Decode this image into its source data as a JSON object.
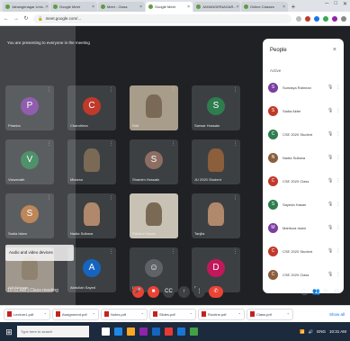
{
  "browser": {
    "tabs": [
      {
        "label": "Jahangirnagar Univ..."
      },
      {
        "label": "Google Meet"
      },
      {
        "label": "Meet - Class"
      },
      {
        "label": "Google Meet",
        "active": true
      },
      {
        "label": "JAHANGIRNAGAR..."
      },
      {
        "label": "Online Classes"
      }
    ],
    "url": "meet.google.com/..."
  },
  "meeting": {
    "banner": "You are presenting to everyone in the meeting",
    "tooltip": "Audio and video devices",
    "meeting_code": "10:31 AM  |  Class meeting",
    "tiles": [
      {
        "name": "Prianka",
        "initial": "P",
        "color": "#7b3fa0",
        "kind": "avatar"
      },
      {
        "name": "Chandrima",
        "initial": "C",
        "color": "#c0392b",
        "kind": "avatar"
      },
      {
        "name": "Rafi",
        "kind": "photo"
      },
      {
        "name": "Sarwar Hossain",
        "initial": "S",
        "color": "#2e7d4f",
        "kind": "avatar"
      },
      {
        "name": "Viswanath",
        "initial": "V",
        "color": "#2e7d4f",
        "kind": "avatar"
      },
      {
        "name": "Mizanur",
        "kind": "cam"
      },
      {
        "name": "Shamim Hossain",
        "initial": "S",
        "color": "#8d6e63",
        "kind": "avatar"
      },
      {
        "name": "JU 2020 Student",
        "kind": "cam2"
      },
      {
        "name": "Sadia Islam",
        "initial": "S",
        "color": "#b0703a",
        "kind": "avatar"
      },
      {
        "name": "Nadia Sultana",
        "kind": "cam3"
      },
      {
        "name": "Rakibul Hasan",
        "kind": "photo2"
      },
      {
        "name": "Tanjila",
        "kind": "cam3"
      },
      {
        "name": "Arif Rahman",
        "kind": "photo3"
      },
      {
        "name": "Abdullah Sayed",
        "initial": "A",
        "color": "#1565c0",
        "kind": "avatar"
      },
      {
        "name": "Dipti",
        "kind": "emoji"
      },
      {
        "name": "Dana",
        "initial": "D",
        "color": "#c2185b",
        "kind": "avatar"
      }
    ],
    "people_panel": {
      "title": "People",
      "section": "Active",
      "rows": [
        {
          "name": "Sumaiya Rahman",
          "color": "#7b3fa0",
          "initial": "S"
        },
        {
          "name": "Sadia Akter",
          "color": "#c0392b",
          "initial": "S"
        },
        {
          "name": "CSE 2020 Student",
          "color": "#2e7d4f",
          "initial": "C"
        },
        {
          "name": "Nadia Sultana",
          "color": "#8b5e3c",
          "initial": "N"
        },
        {
          "name": "CSE 2020 Class",
          "color": "#c0392b",
          "initial": "C"
        },
        {
          "name": "Sayeda Hasan",
          "color": "#2e7d4f",
          "initial": "S"
        },
        {
          "name": "Mahfuza Islam",
          "color": "#7b3fa0",
          "initial": "M"
        },
        {
          "name": "CSE 2020 Student",
          "color": "#c0392b",
          "initial": "C"
        },
        {
          "name": "CSE 2020 Class",
          "color": "#8b5e3c",
          "initial": "C"
        }
      ]
    },
    "controls": {
      "mic": "🎤",
      "cam": "■",
      "cc": "CC",
      "present": "↑",
      "more": "⋮",
      "leave": "✆"
    }
  },
  "downloads": [
    {
      "label": "Lecture1.pdf"
    },
    {
      "label": "Assignment.pdf"
    },
    {
      "label": "Notes.pdf"
    },
    {
      "label": "Slides.pdf"
    },
    {
      "label": "Routine.pdf"
    },
    {
      "label": "Class.pdf"
    }
  ],
  "downloads_showall": "Show all",
  "taskbar": {
    "search_placeholder": "Type here to search",
    "time": "10:31 AM",
    "lang": "ENG"
  },
  "colors": {
    "meet_bg": "#202124",
    "tile_bg": "#3c4043",
    "leave_red": "#ea4335"
  }
}
